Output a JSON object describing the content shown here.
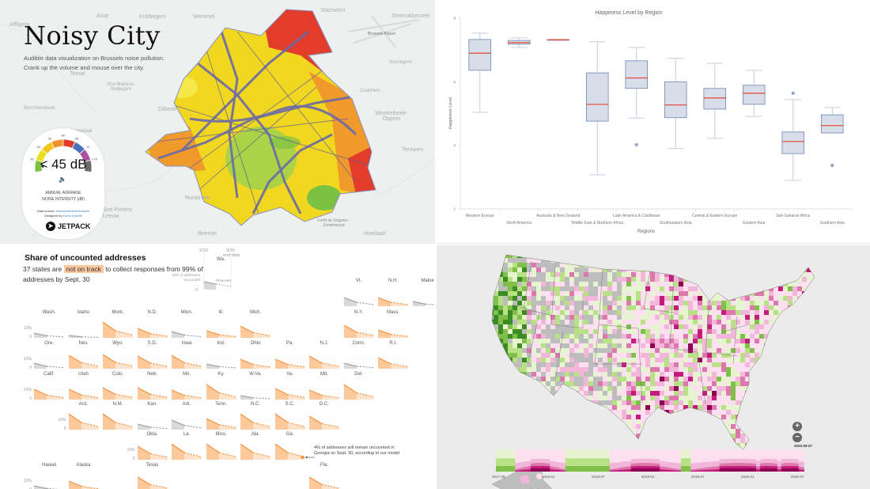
{
  "noisy_city": {
    "title": "Noisy City",
    "subtitle_line1": "Audible data visualization on Brussels noise pollution.",
    "subtitle_line2": "Crank up the volume and mouse over the city.",
    "gauge": {
      "value_label": "< 45 dB",
      "scale_labels": [
        "45",
        "50",
        "55",
        "60",
        "65",
        "70",
        ">75"
      ],
      "scale_colors": [
        "#7cc242",
        "#e8e01c",
        "#f2c318",
        "#f0922c",
        "#e0392b",
        "#4a72b8",
        "#a8539e",
        "#6b6b6b"
      ],
      "caption_line1": "ANNUAL AVERAGE",
      "caption_line2": "NOISE INTENSITY (dB)",
      "source_prefix": "Data source: ",
      "source_link": "environnement.brussels",
      "designer_prefix": "Designed by ",
      "designer_link": "Karim Douïeb",
      "brand": "JETPACK"
    },
    "places": [
      "Asse",
      "Kobbegem",
      "Wemmel",
      "Affligem",
      "Ternat",
      "Sint-Martens-Bodegem",
      "Dilbeek",
      "Borchtlombeek",
      "Machelen",
      "Steenokkerzeel",
      "Brussels Airport",
      "Nossegem",
      "Crainhem",
      "Wezembeek-Oppem",
      "Tervuren",
      "Ruisbroek",
      "Sint-Pieters-Leeuw",
      "Beersel",
      "Hoeilaart",
      "Forêt de Soignes - Zoniënwoud",
      "Schepdaal"
    ]
  },
  "box_chart": {
    "chart_data": {
      "type": "box",
      "title": "Happiness Level by Region",
      "xlabel": "Regions",
      "ylabel": "Happiness Level",
      "ylim": [
        2,
        8
      ],
      "yticks": [
        2,
        4,
        6,
        8
      ],
      "categories": [
        "Western Europe",
        "North America",
        "Australia & New Zealand",
        "Middle East & Northern Africa",
        "Latin America & Caribbean",
        "Southeastern Asia",
        "Central & Eastern Europe",
        "Eastern Asia",
        "Sub-Saharan Africa",
        "Southern Asia"
      ],
      "boxes": [
        {
          "low": 5.04,
          "q1": 6.36,
          "median": 6.9,
          "q3": 7.33,
          "high": 7.53,
          "outliers": []
        },
        {
          "low": 7.08,
          "q1": 7.18,
          "median": 7.23,
          "q3": 7.3,
          "high": 7.38,
          "outliers": []
        },
        {
          "low": 7.31,
          "q1": 7.31,
          "median": 7.32,
          "q3": 7.33,
          "high": 7.33,
          "outliers": []
        },
        {
          "low": 3.07,
          "q1": 4.76,
          "median": 5.29,
          "q3": 6.28,
          "high": 7.26,
          "outliers": []
        },
        {
          "low": 4.86,
          "q1": 5.79,
          "median": 6.12,
          "q3": 6.66,
          "high": 7.08,
          "outliers": [
            4.02
          ]
        },
        {
          "low": 3.9,
          "q1": 4.87,
          "median": 5.27,
          "q3": 6.0,
          "high": 6.74,
          "outliers": []
        },
        {
          "low": 4.22,
          "q1": 5.14,
          "median": 5.49,
          "q3": 5.79,
          "high": 6.58,
          "outliers": []
        },
        {
          "low": 4.91,
          "q1": 5.29,
          "median": 5.64,
          "q3": 5.89,
          "high": 6.36,
          "outliers": []
        },
        {
          "low": 2.9,
          "q1": 3.74,
          "median": 4.12,
          "q3": 4.42,
          "high": 5.44,
          "outliers": [
            5.64
          ]
        },
        {
          "low": 4.39,
          "q1": 4.39,
          "median": 4.62,
          "q3": 4.96,
          "high": 5.19,
          "outliers": [
            3.37
          ]
        }
      ],
      "colors": {
        "box_fill": "#d7deea",
        "box_stroke": "#6f86b3",
        "median": "#e0533f",
        "whisker": "#c5cddd",
        "axis": "#e3e3e3"
      }
    }
  },
  "census": {
    "title": "Share of uncounted addresses",
    "sub_prefix": "37 states are ",
    "sub_highlight": "not on track",
    "sub_suffix": " to collect responses from 99% of addresses by Sept. 30",
    "legend": {
      "date_start": "9/10",
      "date_end": "9/30",
      "end_label": "end date",
      "y_label": "10% of addresses uncounted",
      "zero": "0",
      "projected": "Projected",
      "state": "Wa."
    },
    "axis_10": "10%",
    "axis_0": "0",
    "note": "4% of addresses will remain uncounted in Georgia on Sept. 30, according to our model",
    "colors": {
      "off_track": "#f5913a",
      "off_track_fill": "#fdc89a",
      "off_track_proj": "#fde3cc",
      "on_track": "#9a9a9a",
      "on_track_fill": "#d9d9d9"
    },
    "states": [
      {
        "name": "Vt.",
        "row": 0,
        "col": 10,
        "off": false,
        "h": 0.55
      },
      {
        "name": "N.H.",
        "row": 0,
        "col": 11,
        "off": true,
        "h": 0.55
      },
      {
        "name": "Maine",
        "row": 0,
        "col": 12,
        "off": false,
        "h": 0.3
      },
      {
        "name": "Wash.",
        "row": 1,
        "col": 1,
        "off": false,
        "h": 0.3
      },
      {
        "name": "Idaho",
        "row": 1,
        "col": 2,
        "off": false,
        "h": 0.15
      },
      {
        "name": "Mont.",
        "row": 1,
        "col": 3,
        "off": true,
        "h": 1.0
      },
      {
        "name": "N.D.",
        "row": 1,
        "col": 4,
        "off": true,
        "h": 0.6
      },
      {
        "name": "Minn.",
        "row": 1,
        "col": 5,
        "off": false,
        "h": 0.4
      },
      {
        "name": "Ill.",
        "row": 1,
        "col": 6,
        "off": true,
        "h": 0.45
      },
      {
        "name": "Mich.",
        "row": 1,
        "col": 7,
        "off": true,
        "h": 0.75
      },
      {
        "name": "N.Y.",
        "row": 1,
        "col": 10,
        "off": true,
        "h": 0.8
      },
      {
        "name": "Mass.",
        "row": 1,
        "col": 11,
        "off": true,
        "h": 0.5
      },
      {
        "name": "Ore.",
        "row": 2,
        "col": 1,
        "off": false,
        "h": 0.35
      },
      {
        "name": "Nev.",
        "row": 2,
        "col": 2,
        "off": true,
        "h": 0.85
      },
      {
        "name": "Wyo.",
        "row": 2,
        "col": 3,
        "off": true,
        "h": 0.9
      },
      {
        "name": "S.D.",
        "row": 2,
        "col": 4,
        "off": true,
        "h": 0.8
      },
      {
        "name": "Iowa",
        "row": 2,
        "col": 5,
        "off": true,
        "h": 0.85
      },
      {
        "name": "Ind.",
        "row": 2,
        "col": 6,
        "off": false,
        "h": 0.3
      },
      {
        "name": "Ohio",
        "row": 2,
        "col": 7,
        "off": true,
        "h": 0.6
      },
      {
        "name": "Pa.",
        "row": 2,
        "col": 8,
        "off": true,
        "h": 0.6
      },
      {
        "name": "N.J.",
        "row": 2,
        "col": 9,
        "off": true,
        "h": 0.8
      },
      {
        "name": "Conn.",
        "row": 2,
        "col": 10,
        "off": false,
        "h": 0.35
      },
      {
        "name": "R.I.",
        "row": 2,
        "col": 11,
        "off": true,
        "h": 0.7
      },
      {
        "name": "Calif.",
        "row": 3,
        "col": 1,
        "off": true,
        "h": 0.65
      },
      {
        "name": "Utah",
        "row": 3,
        "col": 2,
        "off": true,
        "h": 0.65
      },
      {
        "name": "Colo.",
        "row": 3,
        "col": 3,
        "off": true,
        "h": 0.75
      },
      {
        "name": "Neb.",
        "row": 3,
        "col": 4,
        "off": true,
        "h": 0.75
      },
      {
        "name": "Mo.",
        "row": 3,
        "col": 5,
        "off": true,
        "h": 0.6
      },
      {
        "name": "Ky.",
        "row": 3,
        "col": 6,
        "off": true,
        "h": 0.95
      },
      {
        "name": "W.Va.",
        "row": 3,
        "col": 7,
        "off": false,
        "h": 0.25
      },
      {
        "name": "Va.",
        "row": 3,
        "col": 8,
        "off": true,
        "h": 0.7
      },
      {
        "name": "Md.",
        "row": 3,
        "col": 9,
        "off": true,
        "h": 0.6
      },
      {
        "name": "Del.",
        "row": 3,
        "col": 10,
        "off": true,
        "h": 0.95
      },
      {
        "name": "Ariz.",
        "row": 4,
        "col": 2,
        "off": true,
        "h": 1.0
      },
      {
        "name": "N.M.",
        "row": 4,
        "col": 3,
        "off": true,
        "h": 1.0
      },
      {
        "name": "Kan.",
        "row": 4,
        "col": 4,
        "off": false,
        "h": 0.35
      },
      {
        "name": "Ark.",
        "row": 4,
        "col": 5,
        "off": false,
        "h": 0.6
      },
      {
        "name": "Tenn.",
        "row": 4,
        "col": 6,
        "off": true,
        "h": 0.7
      },
      {
        "name": "N.C.",
        "row": 4,
        "col": 7,
        "off": true,
        "h": 1.0
      },
      {
        "name": "S.C.",
        "row": 4,
        "col": 8,
        "off": true,
        "h": 1.0
      },
      {
        "name": "D.C.",
        "row": 4,
        "col": 9,
        "off": true,
        "h": 0.85
      },
      {
        "name": "Okla.",
        "row": 5,
        "col": 4,
        "off": true,
        "h": 0.85
      },
      {
        "name": "La.",
        "row": 5,
        "col": 5,
        "off": true,
        "h": 1.0
      },
      {
        "name": "Miss.",
        "row": 5,
        "col": 6,
        "off": true,
        "h": 1.0
      },
      {
        "name": "Ala.",
        "row": 5,
        "col": 7,
        "off": true,
        "h": 1.0
      },
      {
        "name": "Ga.",
        "row": 5,
        "col": 8,
        "off": true,
        "h": 1.0
      },
      {
        "name": "Hawaii",
        "row": 6,
        "col": 1,
        "off": false,
        "h": 0.3
      },
      {
        "name": "Alaska",
        "row": 6,
        "col": 2,
        "off": true,
        "h": 0.6
      },
      {
        "name": "Texas",
        "row": 6,
        "col": 4,
        "off": true,
        "h": 0.85
      },
      {
        "name": "Fla.",
        "row": 6,
        "col": 9,
        "off": true,
        "h": 0.85
      }
    ]
  },
  "us_map": {
    "zoom_in": "+",
    "zoom_out": "−",
    "current_date": "2020-09-07",
    "timeline_labels": [
      "2017-08",
      "2018-01",
      "2018-07",
      "2019-01",
      "2019-07",
      "2020-01",
      "2020-07"
    ],
    "palette": [
      "#3c8c24",
      "#7fbf4a",
      "#b8e186",
      "#e6f5d0",
      "#fde0ef",
      "#f1b6da",
      "#de77ae",
      "#c51b7d",
      "#8e0152",
      "#bdbdbd"
    ]
  }
}
